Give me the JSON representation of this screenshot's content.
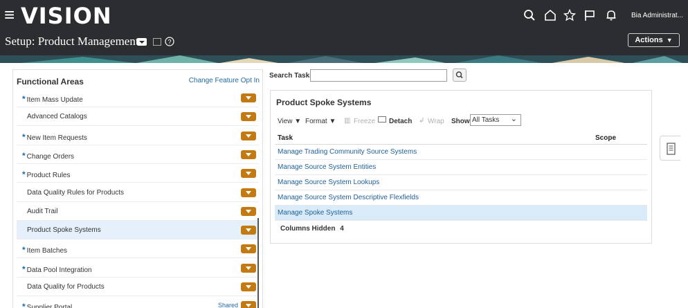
{
  "header": {
    "logo": "VISION",
    "page_title": "Setup: Product Management",
    "user_name": "Bia Administrat...",
    "actions_label": "Actions"
  },
  "icons": {
    "menu": "hamburger-icon",
    "search": "search-icon",
    "home": "home-icon",
    "favorites": "star-icon",
    "flag": "flag-icon",
    "notifications": "bell-icon",
    "help": "help-icon",
    "task_list": "document-icon"
  },
  "functional_areas": {
    "title": "Functional Areas",
    "change_link": "Change Feature Opt In",
    "items": [
      {
        "label": "Item Mass Update",
        "required": true,
        "shared": ""
      },
      {
        "label": "Advanced Catalogs",
        "required": false,
        "shared": ""
      },
      {
        "label": "New Item Requests",
        "required": true,
        "shared": ""
      },
      {
        "label": "Change Orders",
        "required": true,
        "shared": ""
      },
      {
        "label": "Product Rules",
        "required": true,
        "shared": ""
      },
      {
        "label": "Data Quality Rules for Products",
        "required": false,
        "shared": ""
      },
      {
        "label": "Audit Trail",
        "required": false,
        "shared": ""
      },
      {
        "label": "Product Spoke Systems",
        "required": false,
        "shared": "",
        "selected": true
      },
      {
        "label": "Item Batches",
        "required": true,
        "shared": ""
      },
      {
        "label": "Data Pool Integration",
        "required": true,
        "shared": ""
      },
      {
        "label": "Data Quality for Products",
        "required": false,
        "shared": ""
      },
      {
        "label": "Supplier Portal",
        "required": true,
        "shared": "Shared"
      }
    ]
  },
  "search": {
    "label": "Search Tasks",
    "value": "",
    "placeholder": ""
  },
  "spoke": {
    "title": "Product Spoke Systems",
    "toolbar": {
      "view": "View ▼",
      "format": "Format ▼",
      "freeze": "Freeze",
      "detach": "Detach",
      "wrap": "Wrap",
      "show_label": "Show",
      "show_value": "All Tasks"
    },
    "columns": {
      "task": "Task",
      "scope": "Scope"
    },
    "tasks": [
      "Manage Trading Community Source Systems",
      "Manage Source System Entities",
      "Manage Source System Lookups",
      "Manage Source System Descriptive Flexfields",
      "Manage Spoke Systems"
    ],
    "selected_task_index": 4,
    "columns_hidden_label": "Columns Hidden",
    "columns_hidden_count": "4"
  },
  "colors": {
    "header_bg": "#2b2d30",
    "link": "#1f5f99",
    "accent_button": "#c47a12",
    "selected_row": "#d9ebf8"
  }
}
